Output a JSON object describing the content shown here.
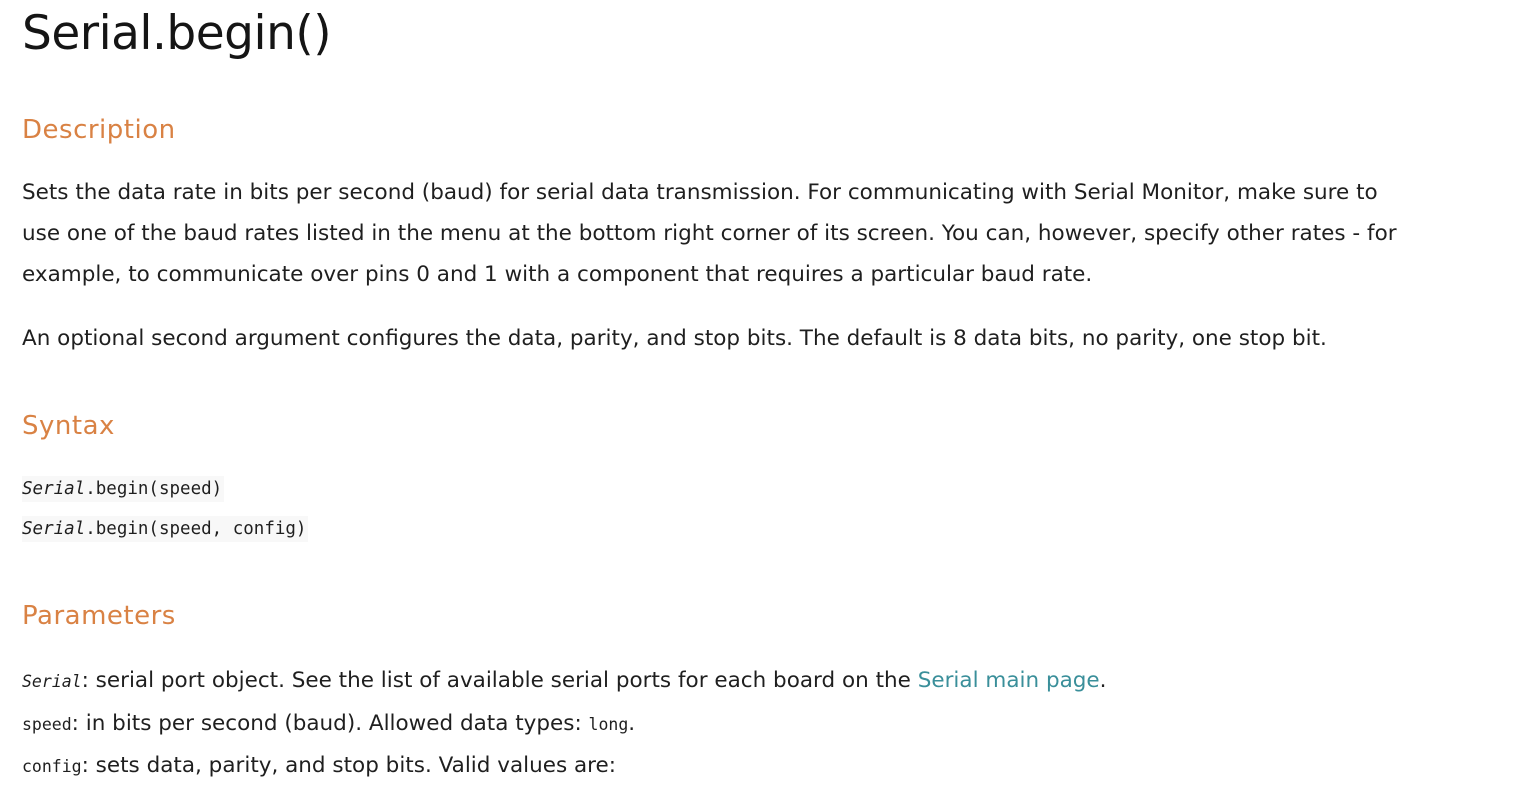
{
  "title": "Serial.begin()",
  "sections": {
    "description": {
      "heading": "Description",
      "paragraphs": [
        "Sets the data rate in bits per second (baud) for serial data transmission. For communicating with Serial Monitor, make sure to use one of the baud rates listed in the menu at the bottom right corner of its screen. You can, however, specify other rates - for example, to communicate over pins 0 and 1 with a component that requires a particular baud rate.",
        "An optional second argument configures the data, parity, and stop bits. The default is 8 data bits, no parity, one stop bit."
      ]
    },
    "syntax": {
      "heading": "Syntax",
      "lines": [
        {
          "object": "Serial",
          "rest": ".begin(speed)"
        },
        {
          "object": "Serial",
          "rest": ".begin(speed, config)"
        }
      ]
    },
    "parameters": {
      "heading": "Parameters",
      "items": [
        {
          "name": "Serial",
          "text": ": serial port object. See the list of available serial ports for each board on the ",
          "link": "Serial main page",
          "suffix": "."
        },
        {
          "name": "speed",
          "text": ": in bits per second (baud). Allowed data types: ",
          "type": "long",
          "suffix": "."
        },
        {
          "name": "config",
          "text": ": sets data, parity, and stop bits. Valid values are:"
        }
      ]
    }
  },
  "colors": {
    "heading": "#d98244",
    "link": "#3a8f9a",
    "text": "#1f1f1f"
  }
}
